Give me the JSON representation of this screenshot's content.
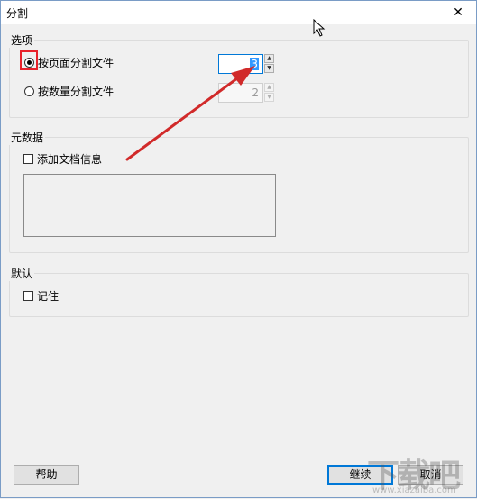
{
  "window": {
    "title": "分割",
    "close_glyph": "✕"
  },
  "options": {
    "group_label": "选项",
    "by_page_label": "按页面分割文件",
    "by_page_value": "3",
    "by_count_label": "按数量分割文件",
    "by_count_value": "2",
    "selected": "by_page"
  },
  "metadata": {
    "group_label": "元数据",
    "add_doc_info_label": "添加文档信息",
    "add_doc_info_checked": false
  },
  "defaults": {
    "group_label": "默认",
    "remember_label": "记住",
    "remember_checked": false
  },
  "buttons": {
    "help": "帮助",
    "continue": "继续",
    "cancel": "取消"
  },
  "watermark": {
    "main": "下载吧",
    "sub": "www.xiazaiba.com"
  },
  "colors": {
    "accent": "#0078d7",
    "annotation_red": "#e8222b"
  }
}
